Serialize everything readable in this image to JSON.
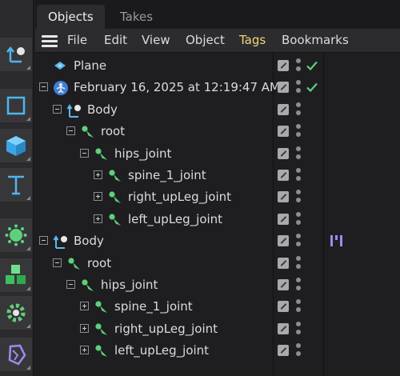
{
  "tabs": [
    {
      "label": "Objects",
      "active": true
    },
    {
      "label": "Takes",
      "active": false
    }
  ],
  "menu": {
    "file": "File",
    "edit": "Edit",
    "view": "View",
    "object": "Object",
    "tags": "Tags",
    "bookmarks": "Bookmarks"
  },
  "tools": [
    {
      "icon": "spline-pen-icon"
    },
    {
      "icon": "rectangle-spline-icon"
    },
    {
      "icon": "cube-icon"
    },
    {
      "icon": "text-icon"
    },
    {
      "icon": "cloner-icon"
    },
    {
      "icon": "volume-icon"
    },
    {
      "icon": "gear-icon"
    },
    {
      "icon": "deformer-icon"
    }
  ],
  "tree": [
    {
      "label": "Plane",
      "icon": "plane-icon",
      "expander": "none",
      "depth": 0,
      "check": true
    },
    {
      "label": "February 16, 2025 at 12:19:47 AM",
      "icon": "null-object-icon",
      "expander": "minus",
      "depth": 0,
      "check": true
    },
    {
      "label": "Body",
      "icon": "skin-body-icon",
      "expander": "minus",
      "depth": 1
    },
    {
      "label": "root",
      "icon": "joint-icon",
      "expander": "minus",
      "depth": 2
    },
    {
      "label": "hips_joint",
      "icon": "joint-icon",
      "expander": "minus",
      "depth": 3
    },
    {
      "label": "spine_1_joint",
      "icon": "joint-icon",
      "expander": "plus",
      "depth": 4
    },
    {
      "label": "right_upLeg_joint",
      "icon": "joint-icon",
      "expander": "plus",
      "depth": 4
    },
    {
      "label": "left_upLeg_joint",
      "icon": "joint-icon",
      "expander": "plus",
      "depth": 4
    },
    {
      "label": "Body",
      "icon": "skin-body-icon",
      "expander": "minus",
      "depth": 0,
      "tag": "ik-tag-icon"
    },
    {
      "label": "root",
      "icon": "joint-icon",
      "expander": "minus",
      "depth": 1
    },
    {
      "label": "hips_joint",
      "icon": "joint-icon",
      "expander": "minus",
      "depth": 2
    },
    {
      "label": "spine_1_joint",
      "icon": "joint-icon",
      "expander": "plus",
      "depth": 3
    },
    {
      "label": "right_upLeg_joint",
      "icon": "joint-icon",
      "expander": "plus",
      "depth": 3
    },
    {
      "label": "left_upLeg_joint",
      "icon": "joint-icon",
      "expander": "plus",
      "depth": 3
    }
  ],
  "colors": {
    "joint": "#5fd07a",
    "check": "#5fd07a",
    "tags_menu": "#f0d67a",
    "tool_blue": "#4fb4f0",
    "tool_green": "#5fd07a",
    "tag_ik": "#9a8cf0"
  }
}
